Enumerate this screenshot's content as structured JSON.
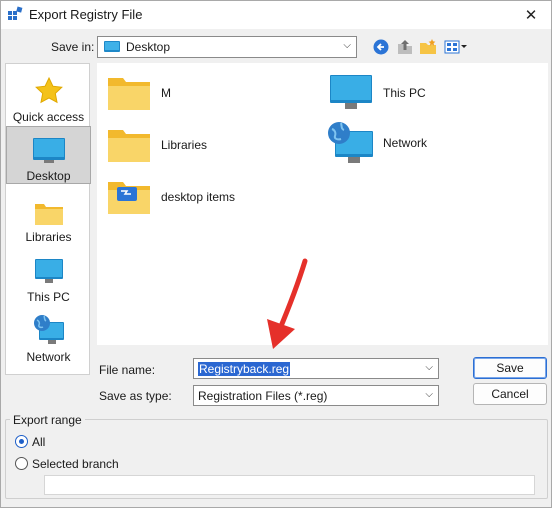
{
  "window": {
    "title": "Export Registry File",
    "close_glyph": "✕"
  },
  "save_in": {
    "label": "Save in:",
    "value": "Desktop",
    "chevron": "⌵"
  },
  "toolbar": {
    "icons": [
      "back-arrow-icon",
      "up-folder-icon",
      "new-folder-icon",
      "view-menu-icon"
    ]
  },
  "places": [
    {
      "label": "Quick access",
      "icon": "star-icon",
      "selected": false
    },
    {
      "label": "Desktop",
      "icon": "desktop-icon",
      "selected": true
    },
    {
      "label": "Libraries",
      "icon": "libraries-icon",
      "selected": false
    },
    {
      "label": "This PC",
      "icon": "this-pc-icon",
      "selected": false
    },
    {
      "label": "Network",
      "icon": "network-icon",
      "selected": false
    }
  ],
  "files": [
    {
      "name": "M",
      "icon": "folder-icon"
    },
    {
      "name": "This PC",
      "icon": "this-pc-icon"
    },
    {
      "name": "Libraries",
      "icon": "libraries-icon"
    },
    {
      "name": "Network",
      "icon": "network-icon"
    },
    {
      "name": "desktop items",
      "icon": "folder-special-icon"
    }
  ],
  "file_name": {
    "label": "File name:",
    "value": "Registryback.reg"
  },
  "save_as_type": {
    "label": "Save as type:",
    "value": "Registration Files (*.reg)"
  },
  "buttons": {
    "save": "Save",
    "cancel": "Cancel"
  },
  "export_range": {
    "title": "Export range",
    "options": [
      {
        "label": "All",
        "checked": true
      },
      {
        "label": "Selected branch",
        "checked": false
      }
    ],
    "branch_value": ""
  },
  "colors": {
    "accent": "#2b67d1",
    "annotation": "#e5302a",
    "folder": "#f6c445",
    "monitor": "#1e88c8"
  }
}
